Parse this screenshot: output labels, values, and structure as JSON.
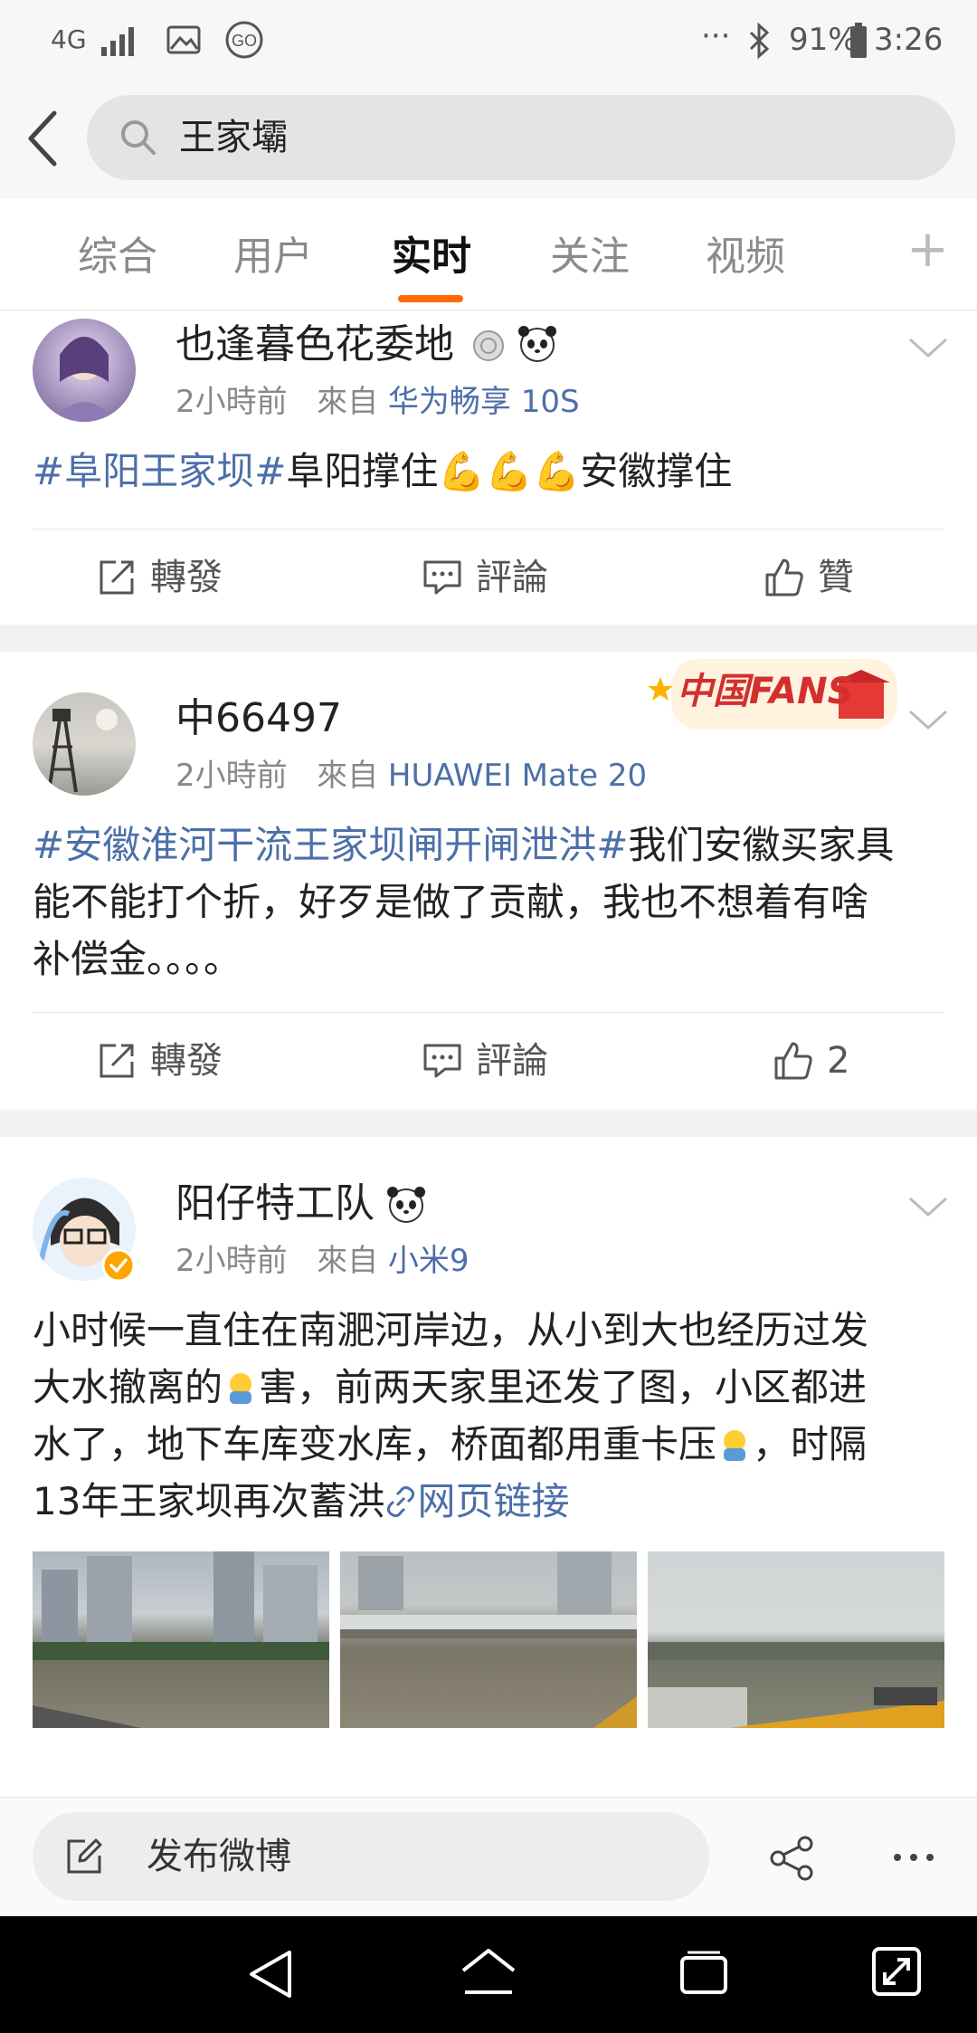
{
  "status_bar": {
    "network": "4G",
    "battery_percent": "91%",
    "time": "3:26",
    "more": "···"
  },
  "search": {
    "query": "王家壩"
  },
  "tabs": [
    {
      "label": "综合"
    },
    {
      "label": "用户"
    },
    {
      "label": "实时"
    },
    {
      "label": "关注"
    },
    {
      "label": "视频"
    },
    {
      "label": "+"
    }
  ],
  "posts": [
    {
      "username": "也逢暮色花委地",
      "time": "2小時前",
      "from_label": "來自",
      "source": "华为畅享 10S",
      "topic": "#阜阳王家坝#",
      "text_before": "阜阳撑住",
      "emoji": "💪💪💪",
      "text_after": "安徽撑住",
      "repost_label": "轉發",
      "comment_label": "評論",
      "like_label": "贊"
    },
    {
      "username": "中66497",
      "badge": "中国FANS",
      "time": "2小時前",
      "from_label": "來自",
      "source": "HUAWEI Mate 20",
      "topic": "#安徽淮河干流王家坝闸开闸泄洪#",
      "text_line1_rest": "我们安徽买家具",
      "text_line2": "能不能打个折，好歹是做了贡献，我也不想着有啥",
      "text_line3": "补偿金。。。。",
      "repost_label": "轉發",
      "comment_label": "評論",
      "like_count": "2"
    },
    {
      "username": "阳仔特工队",
      "time": "2小時前",
      "from_label": "來自",
      "source": "小米9",
      "line1": "小时候一直住在南淝河岸边，从小到大也经历过发",
      "line2a": "大水撤离的",
      "line2b": "害，前两天家里还发了图，小区都进",
      "line3a": "水了，地下车库变水库，桥面都用重卡压",
      "line3b": "，时隔",
      "line4": "13年王家坝再次蓄洪",
      "link_label": "网页链接"
    }
  ],
  "compose": {
    "label": "发布微博"
  }
}
